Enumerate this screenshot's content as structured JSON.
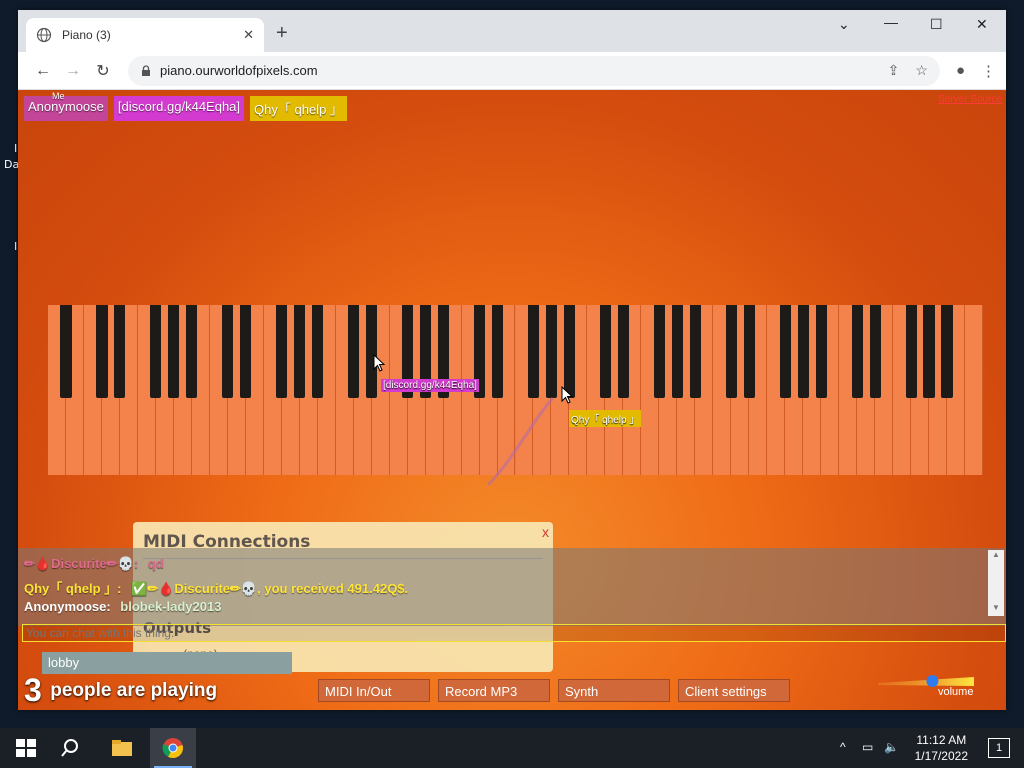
{
  "browser": {
    "tab_title": "Piano (3)",
    "url": "piano.ourworldofpixels.com"
  },
  "desktop": {
    "fragments": [
      "I",
      "Da",
      "I"
    ]
  },
  "page": {
    "badges": [
      {
        "label": "Anonymoose",
        "tag": "Me",
        "color": "#c2459a"
      },
      {
        "label": "[discord.gg/k44Eqha]",
        "color": "#d33bd0"
      },
      {
        "label": "Qhy「 qhelp 」",
        "color": "#e2ba00"
      }
    ],
    "server_source": "Server Source",
    "cursors": [
      {
        "label": "[discord.gg/k44Eqha]",
        "color": "#d33bd0"
      },
      {
        "label": "Qhy「 qhelp 」",
        "color": "#e2ba00"
      }
    ],
    "midi": {
      "title": "MIDI Connections",
      "close": "x",
      "outputs_label": "Outputs",
      "none": "(none)"
    },
    "chat": {
      "messages": [
        {
          "name": "✏🩸Discurite✏💀:",
          "text": "qd",
          "name_color": "#e0698e",
          "text_color": "#e0698e"
        },
        {
          "name": "Qhy「 qhelp 」:",
          "text": "✅✏🩸Discurite✏💀, you received 491.42Q$.",
          "name_color": "#ffe438",
          "text_color": "#ffe438"
        },
        {
          "name": "Anonymoose:",
          "text": "blobek-lady2013",
          "name_color": "#ffffff",
          "text_color": "#ffffff"
        }
      ],
      "input_placeholder": "You can chat with this thing."
    },
    "room": "lobby",
    "players_count": "3",
    "players_text": "people are playing",
    "buttons": [
      "MIDI In/Out",
      "Record MP3",
      "Synth",
      "Client settings"
    ],
    "volume_label": "volume",
    "volume_level": 0.55
  },
  "taskbar": {
    "time": "11:12 AM",
    "date": "1/17/2022",
    "notification_count": "1"
  }
}
